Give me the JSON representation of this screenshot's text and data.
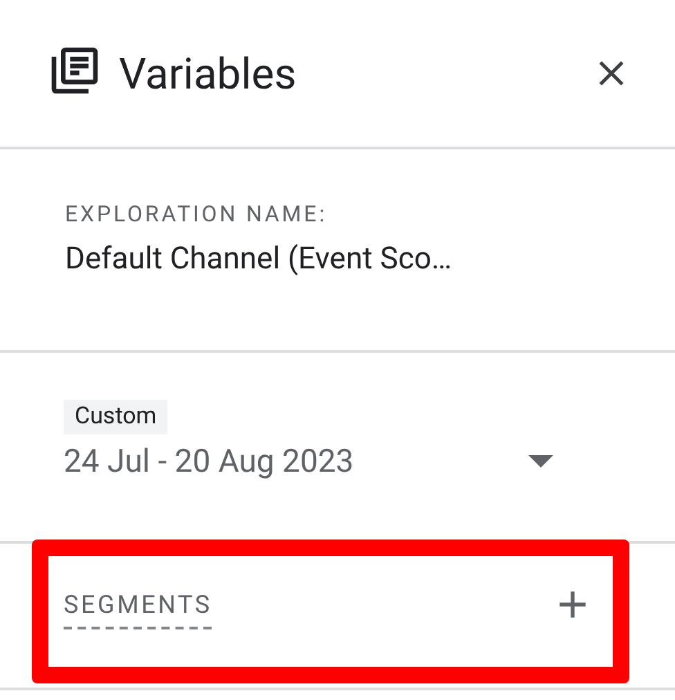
{
  "panel": {
    "title": "Variables"
  },
  "exploration_name": {
    "label": "EXPLORATION NAME:",
    "value": "Default Channel (Event Sco…"
  },
  "date_range": {
    "chip": "Custom",
    "value": "24 Jul - 20 Aug 2023"
  },
  "segments": {
    "label": "SEGMENTS",
    "highlighted": true
  }
}
